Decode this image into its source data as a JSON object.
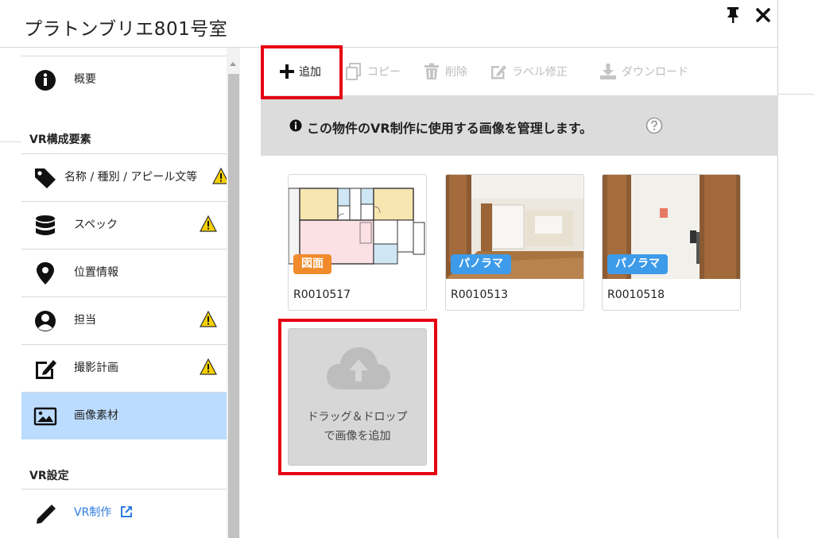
{
  "window": {
    "title": "プラトンブリエ801号室",
    "pin_icon": "pin-icon",
    "close_icon": "close-icon"
  },
  "sidebar": {
    "sections": {
      "vr_elements": "VR構成要素",
      "vr_settings": "VR設定"
    },
    "items": [
      {
        "label": "概要",
        "icon": "info-circle-icon",
        "warning": false,
        "active": false
      },
      {
        "label": "名称 / 種別 / アピール文等",
        "icon": "tag-icon",
        "warning": true,
        "active": false
      },
      {
        "label": "スペック",
        "icon": "database-icon",
        "warning": true,
        "active": false
      },
      {
        "label": "位置情報",
        "icon": "map-marker-icon",
        "warning": false,
        "active": false
      },
      {
        "label": "担当",
        "icon": "user-circle-icon",
        "warning": true,
        "active": false
      },
      {
        "label": "撮影計画",
        "icon": "edit-icon",
        "warning": true,
        "active": false
      },
      {
        "label": "画像素材",
        "icon": "image-icon",
        "warning": false,
        "active": true
      },
      {
        "label": "VR制作",
        "icon": "pencil-icon",
        "warning": false,
        "active": false,
        "external_link": true
      }
    ]
  },
  "toolbar": {
    "add": "追加",
    "copy": "コピー",
    "delete": "削除",
    "edit_label": "ラベル修正",
    "download": "ダウンロード"
  },
  "info": {
    "message": "この物件のVR制作に使用する画像を管理します。",
    "help_icon": "question-circle-icon"
  },
  "images": [
    {
      "name": "R0010517",
      "badge": "図面",
      "badge_color": "#f08a2b"
    },
    {
      "name": "R0010513",
      "badge": "パノラマ",
      "badge_color": "#3d9be9"
    },
    {
      "name": "R0010518",
      "badge": "パノラマ",
      "badge_color": "#3d9be9"
    }
  ],
  "drop_zone": {
    "line1": "ドラッグ＆ドロップ",
    "line2": "で画像を追加",
    "icon": "cloud-upload-icon"
  },
  "colors": {
    "highlight": "#e60012",
    "active_item": "#bcdcff",
    "link": "#2f7de1",
    "warning": "#f5d000"
  }
}
